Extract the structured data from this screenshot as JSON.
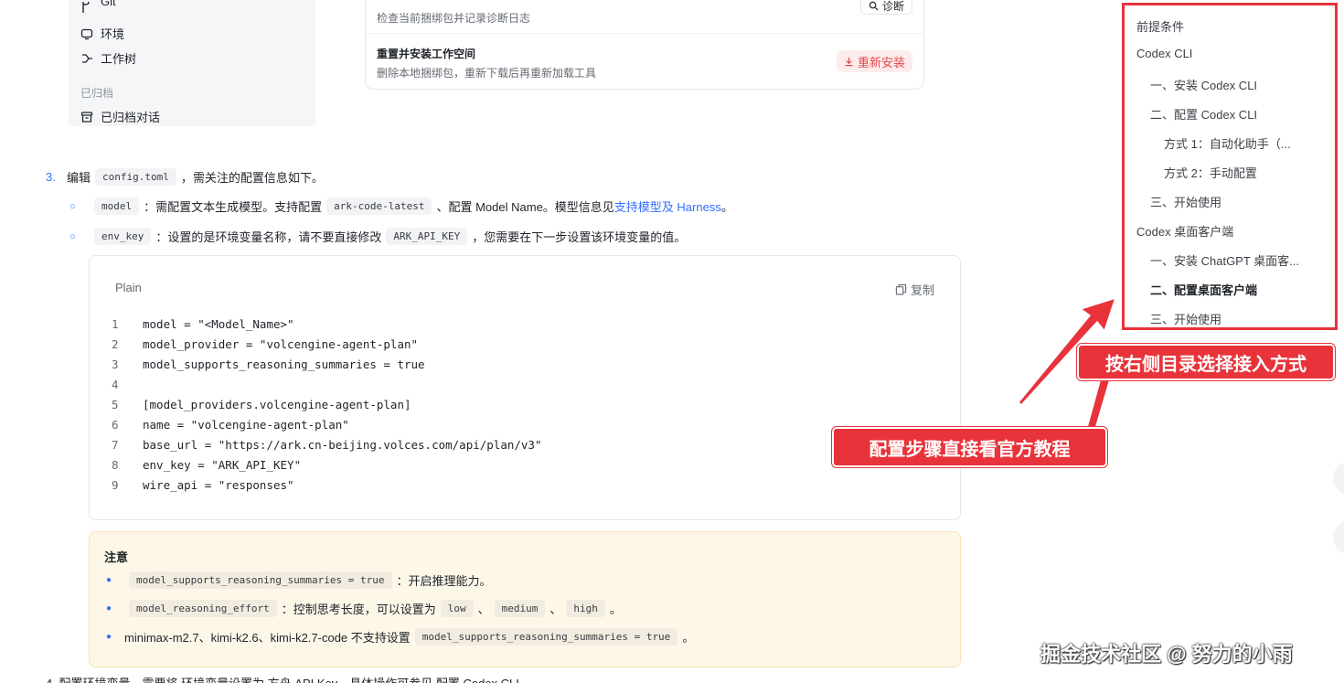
{
  "shot": {
    "sidebar": {
      "git_label": "Git",
      "env_label": "环境",
      "worktree_label": "工作树",
      "archived_section": "已归档",
      "archived_label": "已归档对话"
    },
    "card": {
      "check_desc": "检查当前捆绑包并记录诊断日志",
      "diag_button": "诊断",
      "reinstall_title": "重置并安装工作空间",
      "reinstall_desc": "删除本地捆绑包，重新下载后再重新加载工具",
      "reinstall_button": "重新安装"
    }
  },
  "article": {
    "step3": {
      "num": "3.",
      "pre": "编辑",
      "code": "config.toml",
      "post": "，需关注的配置信息如下。"
    },
    "bullet1": {
      "code": "model",
      "text_a": "：需配置文本生成模型。支持配置",
      "code2": "ark-code-latest",
      "text_b": "、配置 Model Name。模型信息见",
      "link": "支持模型及 Harness",
      "text_c": "。"
    },
    "bullet2": {
      "code": "env_key",
      "text_a": "：设置的是环境变量名称，请不要直接修改",
      "code2": "ARK_API_KEY",
      "text_b": "，您需要在下一步设置该环境变量的值。"
    },
    "codeblock": {
      "lang": "Plain",
      "copy": "复制",
      "lines": [
        {
          "n": "1",
          "t": "model = \"<Model_Name>\""
        },
        {
          "n": "2",
          "t": "model_provider = \"volcengine-agent-plan\""
        },
        {
          "n": "3",
          "t": "model_supports_reasoning_summaries = true"
        },
        {
          "n": "4",
          "t": ""
        },
        {
          "n": "5",
          "t": "[model_providers.volcengine-agent-plan]"
        },
        {
          "n": "6",
          "t": "name = \"volcengine-agent-plan\""
        },
        {
          "n": "7",
          "t": "base_url = \"https://ark.cn-beijing.volces.com/api/plan/v3\""
        },
        {
          "n": "8",
          "t": "env_key = \"ARK_API_KEY\""
        },
        {
          "n": "9",
          "t": "wire_api = \"responses\""
        }
      ]
    },
    "notice": {
      "title": "注意",
      "row1": {
        "code": "model_supports_reasoning_summaries = true",
        "text": "：开启推理能力。"
      },
      "row2": {
        "code": "model_reasoning_effort",
        "text": "：控制思考长度，可以设置为",
        "opt1": "low",
        "sep1": "、",
        "opt2": "medium",
        "sep2": "、",
        "opt3": "high",
        "end": "。"
      },
      "row3": {
        "text": "minimax-m2.7、kimi-k2.6、kimi-k2.7-code 不支持设置",
        "code": "model_supports_reasoning_summaries = true",
        "end": "。"
      }
    },
    "bottom_cut": "4.  配置环境变量，需要将                    环境变量设置为 方舟 API Key，具体操作可参见 配置 Codex CLI"
  },
  "toc": {
    "items": [
      {
        "label": "前提条件",
        "level": 1
      },
      {
        "label": "Codex CLI",
        "level": 1
      },
      {
        "label": "一、安装 Codex CLI",
        "level": 2
      },
      {
        "label": "二、配置 Codex CLI",
        "level": 2
      },
      {
        "label": "方式 1：自动化助手（...",
        "level": 3
      },
      {
        "label": "方式 2：手动配置",
        "level": 3
      },
      {
        "label": "三、开始使用",
        "level": 2
      },
      {
        "label": "Codex 桌面客户端",
        "level": 1
      },
      {
        "label": "一、安装 ChatGPT 桌面客...",
        "level": 2
      },
      {
        "label": "二、配置桌面客户端",
        "level": 2,
        "active": true
      },
      {
        "label": "三、开始使用",
        "level": 2
      }
    ]
  },
  "annotations": {
    "callout1": "按右侧目录选择接入方式",
    "callout2": "配置步骤直接看官方教程",
    "accent": "#e8333a"
  },
  "watermark": "掘金技术社区 @ 努力的小雨"
}
